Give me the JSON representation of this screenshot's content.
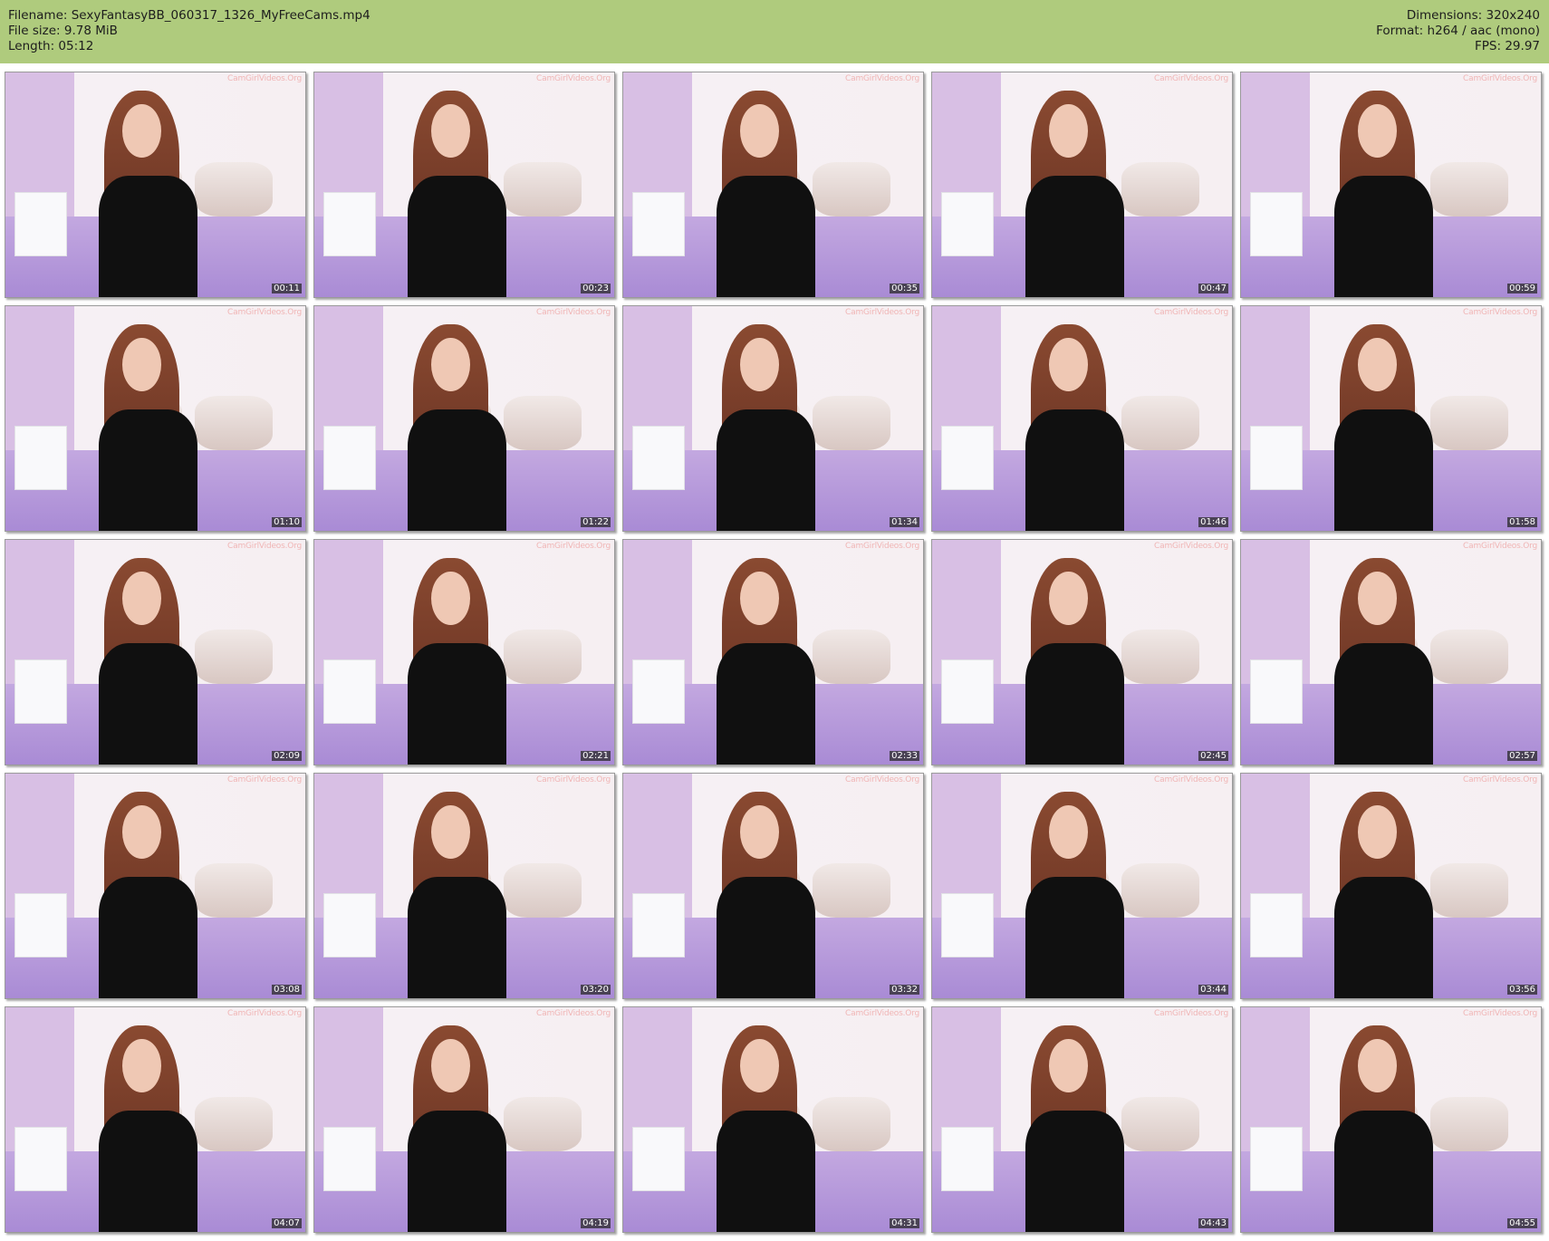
{
  "header": {
    "filename": "Filename: SexyFantasyBB_060317_1326_MyFreeCams.mp4",
    "file_size": "File size: 9.78 MiB",
    "length": "Length: 05:12",
    "dimensions": "Dimensions: 320x240",
    "format": "Format: h264 / aac (mono)",
    "fps": "FPS: 29.97"
  },
  "watermark": "CamGirlVideos.Org",
  "thumbnails": [
    "00:11",
    "00:23",
    "00:35",
    "00:47",
    "00:59",
    "01:10",
    "01:22",
    "01:34",
    "01:46",
    "01:58",
    "02:09",
    "02:21",
    "02:33",
    "02:45",
    "02:57",
    "03:08",
    "03:20",
    "03:32",
    "03:44",
    "03:56",
    "04:07",
    "04:19",
    "04:31",
    "04:43",
    "04:55"
  ]
}
